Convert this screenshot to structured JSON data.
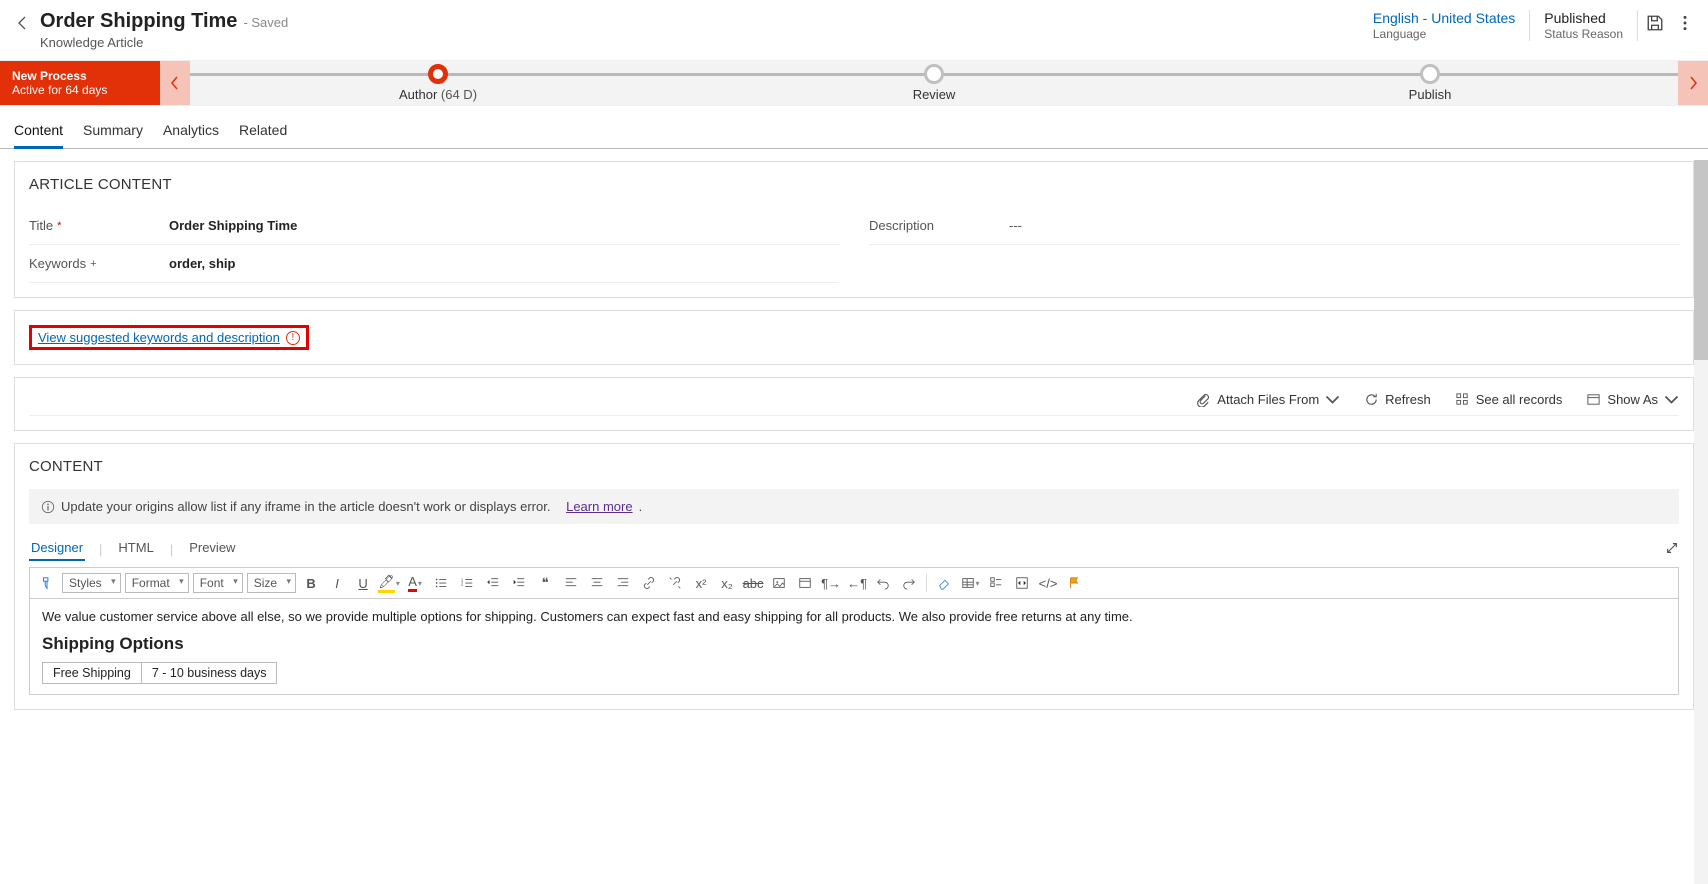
{
  "header": {
    "title": "Order Shipping Time",
    "saved_suffix": "- Saved",
    "subtitle": "Knowledge Article",
    "language": {
      "value": "English - United States",
      "caption": "Language"
    },
    "status": {
      "value": "Published",
      "caption": "Status Reason"
    }
  },
  "process": {
    "name": "New Process",
    "active_for": "Active for 64 days",
    "stages": [
      {
        "label": "Author",
        "days": "(64 D)",
        "active": true
      },
      {
        "label": "Review",
        "days": "",
        "active": false
      },
      {
        "label": "Publish",
        "days": "",
        "active": false
      }
    ]
  },
  "tabs": [
    "Content",
    "Summary",
    "Analytics",
    "Related"
  ],
  "article": {
    "section": "ARTICLE CONTENT",
    "title_label": "Title",
    "title_value": "Order Shipping Time",
    "keywords_label": "Keywords",
    "keywords_value": "order, ship",
    "description_label": "Description",
    "description_value": "---"
  },
  "suggestion_link": "View suggested keywords and description",
  "attach": {
    "attach_files": "Attach Files From",
    "refresh": "Refresh",
    "see_all": "See all records",
    "show_as": "Show As"
  },
  "content": {
    "section": "CONTENT",
    "banner_text": "Update your origins allow list if any iframe in the article doesn't work or displays error.",
    "banner_link": "Learn more",
    "editor_tabs": [
      "Designer",
      "HTML",
      "Preview"
    ],
    "tb": {
      "styles": "Styles",
      "format": "Format",
      "font": "Font",
      "size": "Size"
    },
    "body_para": "We value customer service above all else, so we provide multiple options for shipping. Customers can expect fast and easy shipping for all products. We also provide free returns at any time.",
    "body_heading": "Shipping Options",
    "table": {
      "r1c1": "Free Shipping",
      "r1c2": "7 - 10 business days"
    }
  }
}
